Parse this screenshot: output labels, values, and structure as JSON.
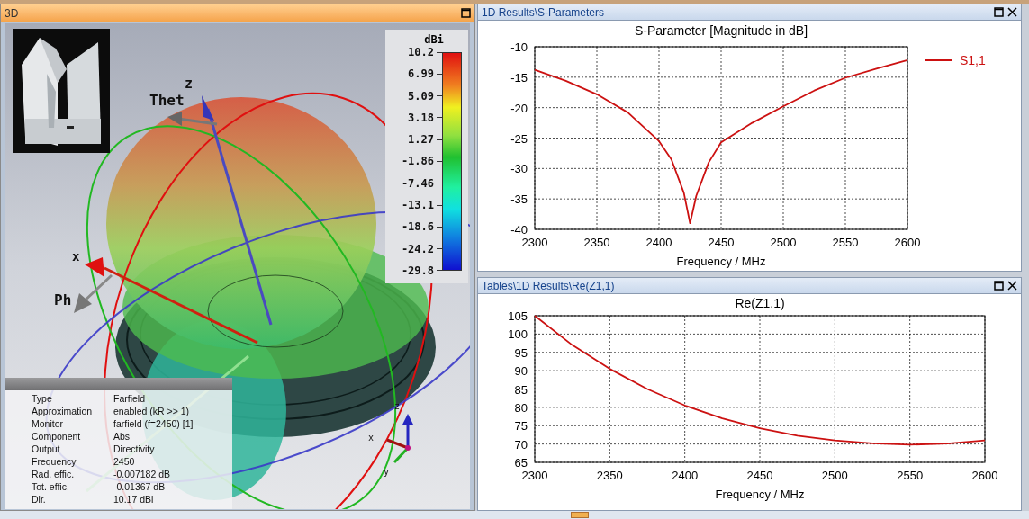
{
  "view3d": {
    "title": "3D",
    "axis_labels": [
      {
        "kind": "z",
        "text": "z"
      },
      {
        "kind": "theta",
        "text": "Thet"
      },
      {
        "kind": "x",
        "text": "x"
      },
      {
        "kind": "phi",
        "text": "Ph"
      },
      {
        "kind": "triad_z",
        "text": "z"
      },
      {
        "kind": "triad_x",
        "text": "x"
      },
      {
        "kind": "triad_y",
        "text": "y"
      }
    ],
    "colorbar": {
      "unit": "dBi",
      "ticks": [
        "10.2",
        "6.99",
        "5.09",
        "3.18",
        "1.27",
        "-1.86",
        "-7.46",
        "-13.1",
        "-18.6",
        "-24.2",
        "-29.8"
      ]
    },
    "info": [
      {
        "label": "Type",
        "value": "Farfield"
      },
      {
        "label": "Approximation",
        "value": "enabled (kR >> 1)"
      },
      {
        "label": "Monitor",
        "value": "farfield (f=2450) [1]"
      },
      {
        "label": "Component",
        "value": "Abs"
      },
      {
        "label": "Output",
        "value": "Directivity"
      },
      {
        "label": "Frequency",
        "value": "2450"
      },
      {
        "label": "Rad. effic.",
        "value": "-0.007182 dB"
      },
      {
        "label": "Tot. effic.",
        "value": "-0.01367 dB"
      },
      {
        "label": "Dir.",
        "value": "10.17 dBi"
      }
    ]
  },
  "sparam": {
    "title": "1D Results\\S-Parameters",
    "chart_data": {
      "type": "line",
      "grid": true,
      "title": "S-Parameter [Magnitude in dB]",
      "xlabel": "Frequency / MHz",
      "xlim": [
        2300,
        2600
      ],
      "ylim": [
        -40,
        -10
      ],
      "xticks": [
        2300,
        2350,
        2400,
        2450,
        2500,
        2550,
        2600
      ],
      "yticks": [
        -10,
        -15,
        -20,
        -25,
        -30,
        -35,
        -40
      ],
      "x": [
        2300,
        2325,
        2350,
        2375,
        2400,
        2410,
        2420,
        2425,
        2430,
        2440,
        2450,
        2475,
        2500,
        2525,
        2550,
        2575,
        2600
      ],
      "series": [
        {
          "name": "S1,1",
          "color": "#cc1111",
          "values": [
            -13.8,
            -15.6,
            -17.8,
            -20.8,
            -25.5,
            -28.5,
            -34,
            -39,
            -34.5,
            -29,
            -25.7,
            -22.5,
            -19.8,
            -17.2,
            -15.1,
            -13.6,
            -12.2
          ]
        }
      ]
    }
  },
  "rez": {
    "title": "Tables\\1D Results\\Re(Z1,1)",
    "chart_data": {
      "type": "line",
      "grid": true,
      "title": "Re(Z1,1)",
      "xlabel": "Frequency / MHz",
      "xlim": [
        2300,
        2600
      ],
      "ylim": [
        65,
        105
      ],
      "xticks": [
        2300,
        2350,
        2400,
        2450,
        2500,
        2550,
        2600
      ],
      "yticks": [
        65,
        70,
        75,
        80,
        85,
        90,
        95,
        100,
        105
      ],
      "x": [
        2300,
        2325,
        2350,
        2375,
        2400,
        2425,
        2450,
        2475,
        2500,
        2525,
        2550,
        2575,
        2600
      ],
      "series": [
        {
          "color": "#cc1111",
          "values": [
            105,
            97,
            90.5,
            85,
            80.5,
            77,
            74.3,
            72.3,
            71,
            70.2,
            69.8,
            70.1,
            71
          ]
        }
      ]
    }
  }
}
